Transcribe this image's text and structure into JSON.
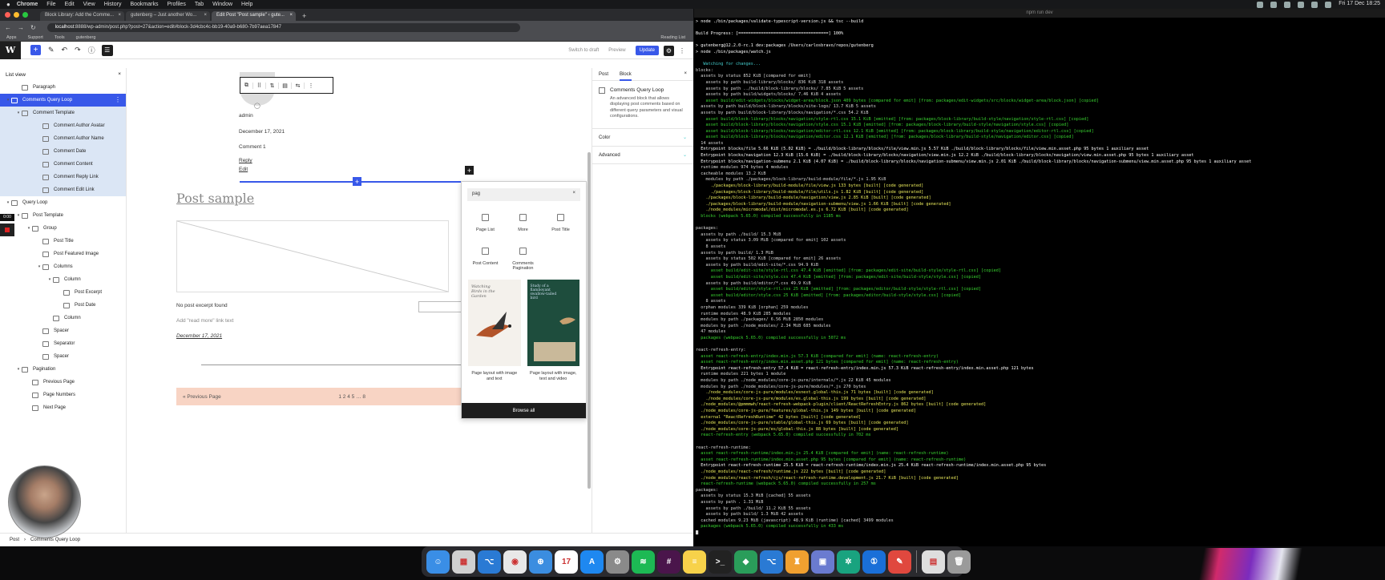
{
  "menubar": {
    "app": "Chrome",
    "items": [
      "File",
      "Edit",
      "View",
      "History",
      "Bookmarks",
      "Profiles",
      "Tab",
      "Window",
      "Help"
    ],
    "clock": "Fri 17 Dec 18:25"
  },
  "browser": {
    "tabs": [
      {
        "label": "Block Library: Add the Comme..."
      },
      {
        "label": "gutenberg – Just another Wo..."
      },
      {
        "label": "Edit Post \"Post sample\" ‹ gute..."
      }
    ],
    "url_host": "localhost",
    "url_rest": ":8888/wp-admin/post.php?post=27&action=edit#block-3d4cbc4c-bb19-40a9-b680-7b97aea17847",
    "bookmarks": [
      "Apps",
      "Support",
      "Tools",
      "gutenberg"
    ],
    "reading_list": "Reading List"
  },
  "wp_toolbar": {
    "switch_to_draft": "Switch to draft",
    "preview": "Preview",
    "update": "Update"
  },
  "list_view": {
    "title": "List view",
    "items": [
      {
        "label": "Paragraph"
      },
      {
        "label": "Comments Query Loop"
      },
      {
        "label": "Comment Template"
      },
      {
        "label": "Comment Author Avatar"
      },
      {
        "label": "Comment Author Name"
      },
      {
        "label": "Comment Date"
      },
      {
        "label": "Comment Content"
      },
      {
        "label": "Comment Reply Link"
      },
      {
        "label": "Comment Edit Link"
      },
      {
        "label": "Query Loop"
      },
      {
        "label": "Post Template"
      },
      {
        "label": "Group"
      },
      {
        "label": "Post Title"
      },
      {
        "label": "Post Featured Image"
      },
      {
        "label": "Columns"
      },
      {
        "label": "Column"
      },
      {
        "label": "Post Excerpt"
      },
      {
        "label": "Post Date"
      },
      {
        "label": "Column"
      },
      {
        "label": "Spacer"
      },
      {
        "label": "Separator"
      },
      {
        "label": "Spacer"
      },
      {
        "label": "Pagination"
      },
      {
        "label": "Previous Page"
      },
      {
        "label": "Page Numbers"
      },
      {
        "label": "Next Page"
      }
    ],
    "overlay_time": "0:00"
  },
  "canvas": {
    "author": "admin",
    "comment_date": "December 17, 2021",
    "comment_text": "Comment 1",
    "reply": "Reply",
    "edit": "Edit",
    "post_title": "Post sample",
    "excerpt": "No post excerpt found",
    "read_more": "Add \"read more\" link text",
    "post_date": "December 17, 2021",
    "prev_page": "« Previous Page",
    "page_numbers": "1 2 4 5 … 8"
  },
  "inserter": {
    "search_value": "pag",
    "blocks": [
      {
        "label": "Page List"
      },
      {
        "label": "More"
      },
      {
        "label": "Post Title"
      },
      {
        "label": "Post Content"
      },
      {
        "label": "Comments Pagination"
      }
    ],
    "patterns": [
      {
        "caption": "Page layout with image and text",
        "img_text": "Watching Birds in the Garden"
      },
      {
        "caption": "Page layout with image, text and video",
        "img_text": "Study of a flamboyant swallow-tailed bird"
      }
    ],
    "browse_all": "Browse all"
  },
  "sidebar": {
    "tab_post": "Post",
    "tab_block": "Block",
    "block_name": "Comments Query Loop",
    "block_desc": "An advanced block that allows displaying post comments based on different query parameters and visual configurations.",
    "panel_color": "Color",
    "panel_advanced": "Advanced"
  },
  "breadcrumb": {
    "root": "Post",
    "current": "Comments Query Loop"
  },
  "terminal": {
    "title": "npm run dev",
    "lines": [
      {
        "t": "> node ./bin/packages/validate-typescript-version.js && tsc --build",
        "k": "w"
      },
      {
        "t": "",
        "k": ""
      },
      {
        "t": "Build Progress: [====================================] 100%",
        "k": "w"
      },
      {
        "t": "",
        "k": ""
      },
      {
        "t": "> gutenberg@12.2.0-rc.1 dev:packages /Users/carlosbravo/repos/gutenberg",
        "k": "w"
      },
      {
        "t": "> node ./bin/packages/watch.js",
        "k": "w"
      },
      {
        "t": "",
        "k": ""
      },
      {
        "t": "   Watching for changes...",
        "k": "c"
      },
      {
        "t": "blocks:",
        "k": ""
      },
      {
        "t": "  assets by status 852 KiB [compared for emit]",
        "k": ""
      },
      {
        "t": "    assets by path build-library/blocks/ 836 KiB 318 assets",
        "k": ""
      },
      {
        "t": "    assets by path ../build/block-library/blocks/ 7.85 KiB 5 assets",
        "k": ""
      },
      {
        "t": "    assets by path build/widgets/blocks/ 7.46 KiB 4 assets",
        "k": ""
      },
      {
        "t": "    asset build/edit-widgets/blocks/widget-area/block.json 409 bytes [compared for emit] [from: packages/edit-widgets/src/blocks/widget-area/block.json] [copied]",
        "k": "g"
      },
      {
        "t": "  assets by path build/block-library/blocks/site-logo/ 13.7 KiB 5 assets",
        "k": ""
      },
      {
        "t": "  assets by path build/block-library/blocks/navigation/*.css 54.2 KiB",
        "k": ""
      },
      {
        "t": "    asset build/block-library/blocks/navigation/style-rtl.css 15.1 KiB [emitted] [from: packages/block-library/build-style/navigation/style-rtl.css] [copied]",
        "k": "g"
      },
      {
        "t": "    asset build/block-library/blocks/navigation/style.css 15.1 KiB [emitted] [from: packages/block-library/build-style/navigation/style.css] [copied]",
        "k": "g"
      },
      {
        "t": "    asset build/block-library/blocks/navigation/editor-rtl.css 12.1 KiB [emitted] [from: packages/block-library/build-style/navigation/editor-rtl.css] [copied]",
        "k": "g"
      },
      {
        "t": "    asset build/block-library/blocks/navigation/editor.css 12.1 KiB [emitted] [from: packages/block-library/build-style/navigation/editor.css] [copied]",
        "k": "g"
      },
      {
        "t": "  14 assets",
        "k": ""
      },
      {
        "t": "  Entrypoint blocks/file 5.66 KiB (5.02 KiB) = ./build/block-library/blocks/file/view.min.js 5.57 KiB ./build/block-library/blocks/file/view.min.asset.php 95 bytes 1 auxiliary asset",
        "k": "w"
      },
      {
        "t": "  Entrypoint blocks/navigation 12.3 KiB (15.6 KiB) = ./build/block-library/blocks/navigation/view.min.js 12.2 KiB ./build/block-library/blocks/navigation/view.min.asset.php 95 bytes 1 auxiliary asset",
        "k": "w"
      },
      {
        "t": "  Entrypoint blocks/navigation-submenu 2.1 KiB (4.07 KiB) = ./build/block-library/blocks/navigation-submenu/view.min.js 2.01 KiB ./build/block-library/blocks/navigation-submenu/view.min.asset.php 95 bytes 1 auxiliary asset",
        "k": "w"
      },
      {
        "t": "  runtime modules 974 bytes 4 modules",
        "k": ""
      },
      {
        "t": "  cacheable modules 13.2 KiB",
        "k": ""
      },
      {
        "t": "    modules by path ./packages/block-library/build-module/file/*.js 1.95 KiB",
        "k": ""
      },
      {
        "t": "      ./packages/block-library/build-module/file/view.js 133 bytes [built] [code generated]",
        "k": "y"
      },
      {
        "t": "      ./packages/block-library/build-module/file/utils.js 1.82 KiB [built] [code generated]",
        "k": "y"
      },
      {
        "t": "    ./packages/block-library/build-module/navigation/view.js 2.85 KiB [built] [code generated]",
        "k": "y"
      },
      {
        "t": "    ./packages/block-library/build-module/navigation-submenu/view.js 1.66 KiB [built] [code generated]",
        "k": "y"
      },
      {
        "t": "    ./node_modules/micromodal/dist/micromodal.es.js 6.72 KiB [built] [code generated]",
        "k": "y"
      },
      {
        "t": "  blocks (webpack 5.65.0) compiled successfully in 1185 ms",
        "k": "g"
      },
      {
        "t": "",
        "k": ""
      },
      {
        "t": "packages:",
        "k": ""
      },
      {
        "t": "  assets by path ./build/ 15.3 MiB",
        "k": ""
      },
      {
        "t": "    assets by status 3.09 MiB [compared for emit] 102 assets",
        "k": ""
      },
      {
        "t": "    8 assets",
        "k": ""
      },
      {
        "t": "  assets by path build/ 1.3 MiB",
        "k": ""
      },
      {
        "t": "    assets by status 502 KiB [compared for emit] 26 assets",
        "k": ""
      },
      {
        "t": "    assets by path build/edit-site/*.css 94.9 KiB",
        "k": ""
      },
      {
        "t": "      asset build/edit-site/style-rtl.css 47.4 KiB [emitted] [from: packages/edit-site/build-style/style-rtl.css] [copied]",
        "k": "g"
      },
      {
        "t": "      asset build/edit-site/style.css 47.4 KiB [emitted] [from: packages/edit-site/build-style/style.css] [copied]",
        "k": "g"
      },
      {
        "t": "    assets by path build/editor/*.css 49.9 KiB",
        "k": ""
      },
      {
        "t": "      asset build/editor/style-rtl.css 25 KiB [emitted] [from: packages/editor/build-style/style-rtl.css] [copied]",
        "k": "g"
      },
      {
        "t": "      asset build/editor/style.css 25 KiB [emitted] [from: packages/editor/build-style/style.css] [copied]",
        "k": "g"
      },
      {
        "t": "    8 assets",
        "k": ""
      },
      {
        "t": "  orphan modules 339 KiB [orphan] 259 modules",
        "k": ""
      },
      {
        "t": "  runtime modules 48.9 KiB 285 modules",
        "k": ""
      },
      {
        "t": "  modules by path ./packages/ 6.56 MiB 2850 modules",
        "k": ""
      },
      {
        "t": "  modules by path ./node_modules/ 2.34 MiB 685 modules",
        "k": ""
      },
      {
        "t": "  47 modules",
        "k": ""
      },
      {
        "t": "  packages (webpack 5.65.0) compiled successfully in 5072 ms",
        "k": "g"
      },
      {
        "t": "",
        "k": ""
      },
      {
        "t": "react-refresh-entry:",
        "k": ""
      },
      {
        "t": "  asset react-refresh-entry/index.min.js 57.3 KiB [compared for emit] (name: react-refresh-entry)",
        "k": "g"
      },
      {
        "t": "  asset react-refresh-entry/index.min.asset.php 121 bytes [compared for emit] (name: react-refresh-entry)",
        "k": "g"
      },
      {
        "t": "  Entrypoint react-refresh-entry 57.4 KiB = react-refresh-entry/index.min.js 57.3 KiB react-refresh-entry/index.min.asset.php 121 bytes",
        "k": "w"
      },
      {
        "t": "  runtime modules 221 bytes 1 module",
        "k": ""
      },
      {
        "t": "  modules by path ./node_modules/core-js-pure/internals/*.js 22 KiB 45 modules",
        "k": ""
      },
      {
        "t": "  modules by path ./node_modules/core-js-pure/modules/*.js 270 bytes",
        "k": ""
      },
      {
        "t": "    ./node_modules/core-js-pure/modules/esnext.global-this.js 71 bytes [built] [code generated]",
        "k": "y"
      },
      {
        "t": "    ./node_modules/core-js-pure/modules/es.global-this.js 199 bytes [built] [code generated]",
        "k": "y"
      },
      {
        "t": "  ./node_modules/@pmmmwh/react-refresh-webpack-plugin/client/ReactRefreshEntry.js 862 bytes [built] [code generated]",
        "k": "y"
      },
      {
        "t": "  ./node_modules/core-js-pure/features/global-this.js 149 bytes [built] [code generated]",
        "k": "y"
      },
      {
        "t": "  external \"ReactRefreshRuntime\" 42 bytes [built] [code generated]",
        "k": "y"
      },
      {
        "t": "  ./node_modules/core-js-pure/stable/global-this.js 69 bytes [built] [code generated]",
        "k": "y"
      },
      {
        "t": "  ./node_modules/core-js-pure/es/global-this.js 88 bytes [built] [code generated]",
        "k": "y"
      },
      {
        "t": "  react-refresh-entry (webpack 5.65.0) compiled successfully in 702 ms",
        "k": "g"
      },
      {
        "t": "",
        "k": ""
      },
      {
        "t": "react-refresh-runtime:",
        "k": ""
      },
      {
        "t": "  asset react-refresh-runtime/index.min.js 25.4 KiB [compared for emit] (name: react-refresh-runtime)",
        "k": "g"
      },
      {
        "t": "  asset react-refresh-runtime/index.min.asset.php 95 bytes [compared for emit] (name: react-refresh-runtime)",
        "k": "g"
      },
      {
        "t": "  Entrypoint react-refresh-runtime 25.5 KiB = react-refresh-runtime/index.min.js 25.4 KiB react-refresh-runtime/index.min.asset.php 95 bytes",
        "k": "w"
      },
      {
        "t": "  ./node_modules/react-refresh/runtime.js 222 bytes [built] [code generated]",
        "k": "y"
      },
      {
        "t": "  ./node_modules/react-refresh/cjs/react-refresh-runtime.development.js 21.7 KiB [built] [code generated]",
        "k": "y"
      },
      {
        "t": "  react-refresh-runtime (webpack 5.65.0) compiled successfully in 257 ms",
        "k": "g"
      },
      {
        "t": "packages:",
        "k": ""
      },
      {
        "t": "  assets by status 15.3 MiB [cached] 55 assets",
        "k": ""
      },
      {
        "t": "  assets by path . 1.31 MiB",
        "k": ""
      },
      {
        "t": "    assets by path ./build/ 11.2 KiB 55 assets",
        "k": ""
      },
      {
        "t": "    assets by path build/ 1.3 MiB 42 assets",
        "k": ""
      },
      {
        "t": "  cached modules 9.23 MiB (javascript) 48.9 KiB (runtime) [cached] 3499 modules",
        "k": ""
      },
      {
        "t": "  packages (webpack 5.65.0) compiled successfully in 433 ms",
        "k": "g"
      }
    ]
  },
  "dock": {
    "apps": [
      {
        "name": "Finder",
        "color": "#3a8ee6",
        "glyph": "☺"
      },
      {
        "name": "Launchpad",
        "color": "#d0d0d0",
        "glyph": "▦"
      },
      {
        "name": "VS Code",
        "color": "#2a7ad4",
        "glyph": "⌥"
      },
      {
        "name": "Chrome",
        "color": "#e8e8e8",
        "glyph": "◉"
      },
      {
        "name": "Safari",
        "color": "#3b8de0",
        "glyph": "⊕"
      },
      {
        "name": "Calendar",
        "color": "#ffffff",
        "glyph": "17"
      },
      {
        "name": "App Store",
        "color": "#1e88f0",
        "glyph": "A"
      },
      {
        "name": "System Preferences",
        "color": "#8a8a8a",
        "glyph": "⚙"
      },
      {
        "name": "Spotify",
        "color": "#1db954",
        "glyph": "≋"
      },
      {
        "name": "Slack",
        "color": "#4a154b",
        "glyph": "#"
      },
      {
        "name": "Notes",
        "color": "#f7d24a",
        "glyph": "≡"
      },
      {
        "name": "Terminal",
        "color": "#222222",
        "glyph": ">_"
      },
      {
        "name": "Sourcetree",
        "color": "#2a9d5a",
        "glyph": "◆"
      },
      {
        "name": "VS Code 2",
        "color": "#2a7ad4",
        "glyph": "⌥"
      },
      {
        "name": "Tower",
        "color": "#f0a030",
        "glyph": "♜"
      },
      {
        "name": "Screen",
        "color": "#6a7bd0",
        "glyph": "▣"
      },
      {
        "name": "ChatGPT",
        "color": "#19a37f",
        "glyph": "✲"
      },
      {
        "name": "1Password",
        "color": "#1a6fd8",
        "glyph": "①"
      },
      {
        "name": "Tool",
        "color": "#e0483e",
        "glyph": "✎"
      },
      {
        "name": "Document",
        "color": "#dedede",
        "glyph": "▤"
      },
      {
        "name": "Trash",
        "color": "#9a9a9a",
        "glyph": "🗑"
      }
    ],
    "calendar_badge": "1"
  },
  "colors": {
    "wp_blue": "#3858e9",
    "selected_row": "#3858e9",
    "sub_rows": "#dbe6f5",
    "pagination_bg": "#f8d4c4",
    "terminal_green": "#38d430"
  }
}
